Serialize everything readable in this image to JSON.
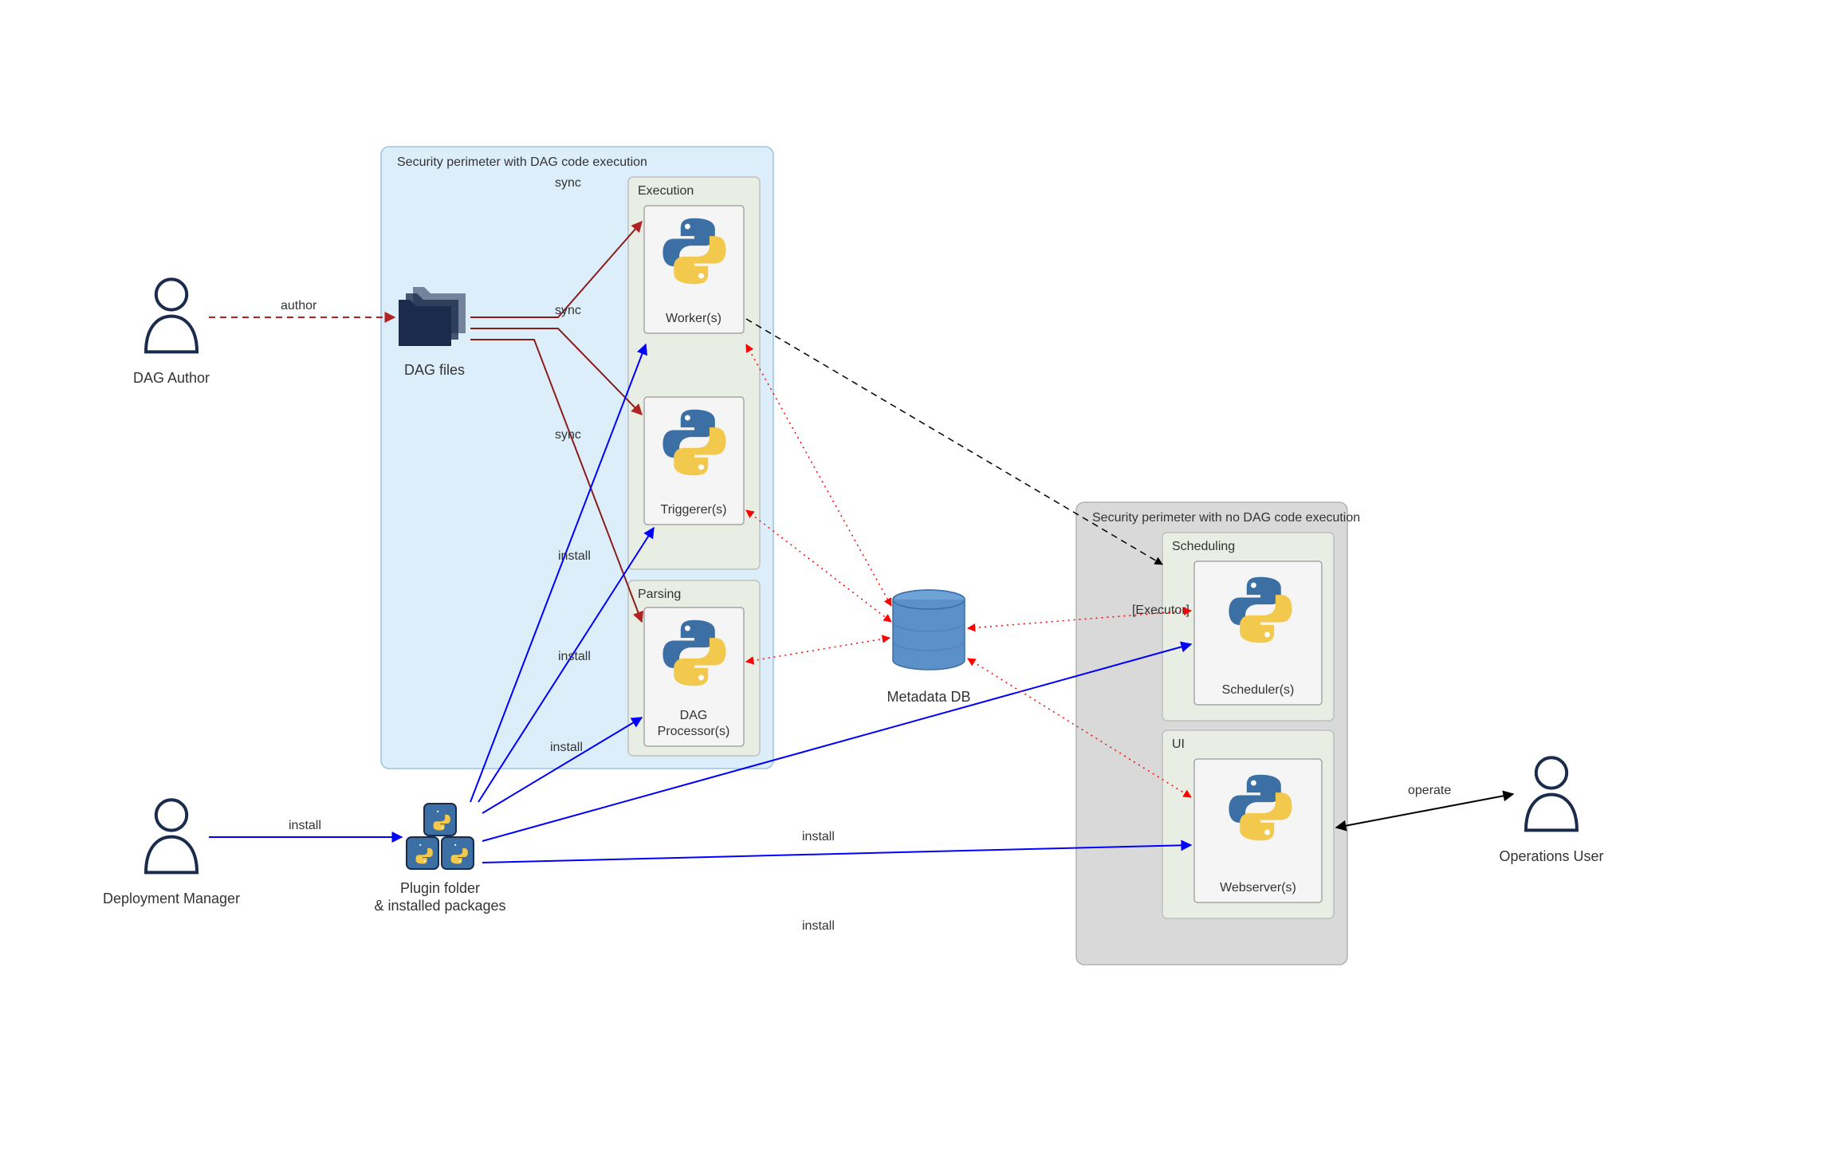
{
  "actors": {
    "dagAuthor": "DAG Author",
    "deploymentManager": "Deployment Manager",
    "operationsUser": "Operations User"
  },
  "nodes": {
    "dagFiles": "DAG files",
    "pluginFolder1": "Plugin folder",
    "pluginFolder2": "& installed packages",
    "metadataDB": "Metadata DB"
  },
  "perimeters": {
    "left": "Security perimeter with DAG code execution",
    "right": "Security perimeter with no DAG code execution"
  },
  "groups": {
    "execution": "Execution",
    "parsing": "Parsing",
    "scheduling": "Scheduling",
    "ui": "UI"
  },
  "components": {
    "workers": "Worker(s)",
    "triggerers": "Triggerer(s)",
    "dagProcessors1": "DAG",
    "dagProcessors2": "Processor(s)",
    "schedulers": "Scheduler(s)",
    "webservers": "Webserver(s)",
    "executor": "[Executor]"
  },
  "edges": {
    "author": "author",
    "sync": "sync",
    "install": "install",
    "operate": "operate"
  },
  "colors": {
    "bluePerimFill": "#DDEEFB",
    "bluePerimStroke": "#9EC4E2",
    "grayPerimFill": "#D9D9D9",
    "grayPerimStroke": "#B3B3B3",
    "groupFill": "#E8EEE3",
    "groupStroke": "#BFBFBF",
    "compFill": "#F5F5F5",
    "compStroke": "#A6A6A6",
    "edgeBlue": "#0000FF",
    "edgeRed": "#B22222",
    "edgeRedBright": "#FF0000",
    "edgeBlack": "#000000",
    "dbFill": "#5B90C8",
    "dbStroke": "#3A6FA5",
    "textColor": "#333333",
    "actorStroke": "#1A2B4C"
  }
}
